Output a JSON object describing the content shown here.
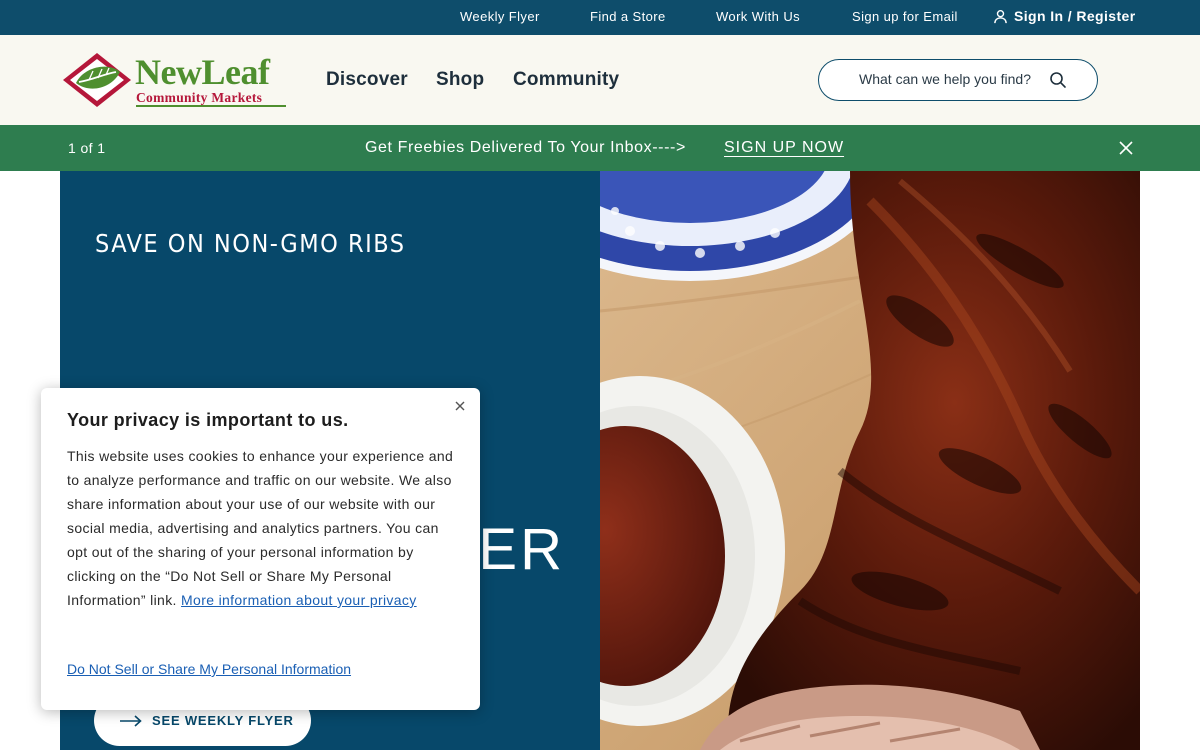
{
  "utility_bar": {
    "links": [
      "Weekly Flyer",
      "Find a Store",
      "Work With Us",
      "Sign up for Email"
    ],
    "signin_label": "Sign In / Register",
    "bg_color": "#0e4d6b"
  },
  "header": {
    "logo": {
      "name": "NewLeaf",
      "subtitle": "Community Markets"
    },
    "nav": [
      "Discover",
      "Shop",
      "Community"
    ],
    "search": {
      "placeholder": "What can we help you find?",
      "value": ""
    }
  },
  "announcement": {
    "counter": "1 of 1",
    "text": "Get Freebies Delivered To Your Inbox---->",
    "link_label": "SIGN UP NOW",
    "bg_color": "#2e7d4f"
  },
  "hero": {
    "eyebrow": "SAVE ON NON-GMO RIBS",
    "headline_visible": "ER",
    "cta_label": "SEE WEEKLY FLYER",
    "panel_color": "#07486a",
    "image_icon": "bbq-ribs-photo"
  },
  "privacy": {
    "title": "Your privacy is important to us.",
    "body": "This website uses cookies to enhance your experience and to analyze performance and traffic on our website. We also share information about your use of our website with our social media, advertising and analytics partners. You can opt out of the sharing of your personal information by clicking on the “Do Not Sell or Share My Personal Information” link.",
    "more_link": "More information about your privacy",
    "opt_out_link": "Do Not Sell or Share My Personal Information"
  }
}
